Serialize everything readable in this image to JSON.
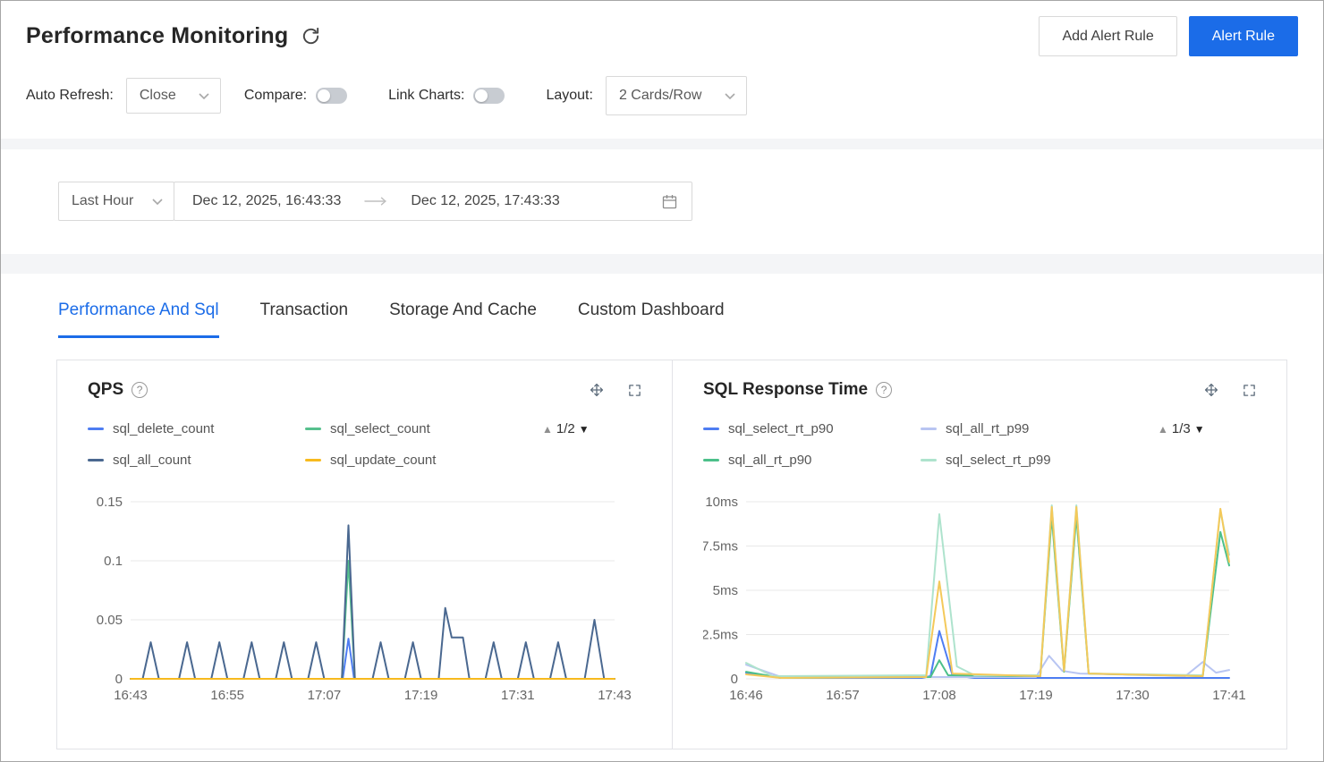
{
  "colors": {
    "accent": "#1b6ce8",
    "band_bg": "#f4f5f7",
    "card_border": "#e2e3e7",
    "control_border": "#d9d9d9",
    "grid_line": "#e8e8e8",
    "toggle_off": "#c8ccd2",
    "text_primary": "#262626",
    "text_secondary": "#666666"
  },
  "header": {
    "title": "Performance Monitoring",
    "buttons": {
      "add_alert_rule": "Add Alert Rule",
      "alert_rule": "Alert Rule"
    }
  },
  "controls": {
    "auto_refresh": {
      "label": "Auto Refresh:",
      "value": "Close"
    },
    "compare": {
      "label": "Compare:",
      "enabled": false
    },
    "link_charts": {
      "label": "Link Charts:",
      "enabled": false
    },
    "layout": {
      "label": "Layout:",
      "value": "2 Cards/Row"
    }
  },
  "time_filter": {
    "preset": "Last Hour",
    "start": "Dec 12, 2025, 16:43:33",
    "end": "Dec 12, 2025, 17:43:33"
  },
  "tabs": [
    {
      "label": "Performance And Sql",
      "active": true
    },
    {
      "label": "Transaction",
      "active": false
    },
    {
      "label": "Storage And Cache",
      "active": false
    },
    {
      "label": "Custom Dashboard",
      "active": false
    }
  ],
  "chart_data": [
    {
      "type": "line",
      "title": "QPS",
      "legend_page": "1/2",
      "x_ticks": [
        "16:43",
        "16:55",
        "17:07",
        "17:19",
        "17:31",
        "17:43"
      ],
      "x_range": [
        0,
        60
      ],
      "ylim": [
        0,
        0.15
      ],
      "y_ticks": [
        {
          "v": 0,
          "label": "0"
        },
        {
          "v": 0.05,
          "label": "0.05"
        },
        {
          "v": 0.1,
          "label": "0.1"
        },
        {
          "v": 0.15,
          "label": "0.15"
        }
      ],
      "series": [
        {
          "name": "sql_delete_count",
          "color": "#4e7df2",
          "in_legend": true,
          "points": [
            [
              0,
              0
            ],
            [
              26.3,
              0
            ],
            [
              27,
              0.034
            ],
            [
              27.7,
              0
            ],
            [
              60,
              0
            ]
          ]
        },
        {
          "name": "sql_select_count",
          "color": "#56c08d",
          "in_legend": true,
          "points": [
            [
              0,
              0
            ],
            [
              26.2,
              0
            ],
            [
              27,
              0.1
            ],
            [
              27.8,
              0
            ],
            [
              60,
              0
            ]
          ]
        },
        {
          "name": "sql_all_count",
          "color": "#4a6890",
          "in_legend": true,
          "points": [
            [
              0,
              0
            ],
            [
              1.5,
              0
            ],
            [
              2.5,
              0.031
            ],
            [
              3.5,
              0
            ],
            [
              6,
              0
            ],
            [
              7,
              0.031
            ],
            [
              8,
              0
            ],
            [
              10,
              0
            ],
            [
              11,
              0.031
            ],
            [
              12,
              0
            ],
            [
              14,
              0
            ],
            [
              15,
              0.031
            ],
            [
              16,
              0
            ],
            [
              18,
              0
            ],
            [
              19,
              0.031
            ],
            [
              20,
              0
            ],
            [
              22,
              0
            ],
            [
              23,
              0.031
            ],
            [
              24,
              0
            ],
            [
              26.2,
              0
            ],
            [
              27,
              0.13
            ],
            [
              27.8,
              0
            ],
            [
              30,
              0
            ],
            [
              31,
              0.031
            ],
            [
              32,
              0
            ],
            [
              34,
              0
            ],
            [
              35,
              0.031
            ],
            [
              36,
              0
            ],
            [
              38.2,
              0
            ],
            [
              39,
              0.06
            ],
            [
              39.8,
              0.035
            ],
            [
              41.2,
              0.035
            ],
            [
              42,
              0
            ],
            [
              44,
              0
            ],
            [
              45,
              0.031
            ],
            [
              46,
              0
            ],
            [
              48,
              0
            ],
            [
              49,
              0.031
            ],
            [
              50,
              0
            ],
            [
              52,
              0
            ],
            [
              53,
              0.031
            ],
            [
              54,
              0
            ],
            [
              56.3,
              0
            ],
            [
              57.5,
              0.05
            ],
            [
              58.7,
              0
            ],
            [
              60,
              0
            ]
          ]
        },
        {
          "name": "sql_update_count",
          "color": "#f7ba1e",
          "in_legend": true,
          "points": [
            [
              0,
              0
            ],
            [
              60,
              0
            ]
          ]
        }
      ]
    },
    {
      "type": "line",
      "title": "SQL Response Time",
      "legend_page": "1/3",
      "x_ticks": [
        "16:46",
        "16:57",
        "17:08",
        "17:19",
        "17:30",
        "17:41"
      ],
      "x_range": [
        0,
        55
      ],
      "ylim": [
        0,
        10
      ],
      "y_ticks": [
        {
          "v": 0,
          "label": "0"
        },
        {
          "v": 2.5,
          "label": "2.5ms"
        },
        {
          "v": 5,
          "label": "5ms"
        },
        {
          "v": 7.5,
          "label": "7.5ms"
        },
        {
          "v": 10,
          "label": "10ms"
        }
      ],
      "series": [
        {
          "name": "sql_select_rt_p90",
          "color": "#4e7df2",
          "in_legend": true,
          "points": [
            [
              0,
              0.35
            ],
            [
              4,
              0.05
            ],
            [
              20,
              0.05
            ],
            [
              21,
              0.15
            ],
            [
              22,
              2.7
            ],
            [
              23.5,
              0.2
            ],
            [
              26,
              0.05
            ],
            [
              54,
              0.05
            ],
            [
              55,
              0.05
            ]
          ]
        },
        {
          "name": "sql_all_rt_p99",
          "color": "#b8c5f2",
          "in_legend": true,
          "points": [
            [
              0,
              0.8
            ],
            [
              4,
              0.1
            ],
            [
              33,
              0.1
            ],
            [
              34.5,
              1.3
            ],
            [
              36,
              0.45
            ],
            [
              38,
              0.3
            ],
            [
              50,
              0.15
            ],
            [
              52,
              0.95
            ],
            [
              53.5,
              0.35
            ],
            [
              55,
              0.5
            ]
          ]
        },
        {
          "name": "sql_all_rt_p90",
          "color": "#4cc08a",
          "in_legend": true,
          "points": [
            [
              0,
              0.4
            ],
            [
              4,
              0.05
            ],
            [
              21,
              0.1
            ],
            [
              22,
              1.05
            ],
            [
              23,
              0.2
            ],
            [
              33.5,
              0.15
            ],
            [
              34.8,
              9.2
            ],
            [
              36.2,
              0.4
            ],
            [
              37.6,
              9.2
            ],
            [
              39,
              0.3
            ],
            [
              52,
              0.15
            ],
            [
              54,
              8.3
            ],
            [
              55,
              6.4
            ]
          ]
        },
        {
          "name": "sql_select_rt_p99",
          "color": "#aee3cd",
          "in_legend": true,
          "points": [
            [
              0,
              0.9
            ],
            [
              3,
              0.15
            ],
            [
              20.5,
              0.2
            ],
            [
              22,
              9.3
            ],
            [
              24,
              0.7
            ],
            [
              26,
              0.2
            ],
            [
              33.5,
              0.2
            ],
            [
              34.8,
              9.8
            ],
            [
              36.2,
              0.5
            ],
            [
              37.6,
              9.8
            ],
            [
              39,
              0.3
            ],
            [
              52,
              0.2
            ],
            [
              54,
              9.5
            ],
            [
              55,
              7.0
            ]
          ]
        },
        {
          "name": "",
          "color": "#f4c95a",
          "in_legend": false,
          "points": [
            [
              0,
              0.25
            ],
            [
              4,
              0.05
            ],
            [
              20.5,
              0.1
            ],
            [
              22,
              5.5
            ],
            [
              23.5,
              0.3
            ],
            [
              33.5,
              0.15
            ],
            [
              34.8,
              9.7
            ],
            [
              36.2,
              0.45
            ],
            [
              37.6,
              9.7
            ],
            [
              39,
              0.3
            ],
            [
              52,
              0.15
            ],
            [
              54,
              9.6
            ],
            [
              55,
              6.6
            ]
          ]
        }
      ]
    }
  ]
}
